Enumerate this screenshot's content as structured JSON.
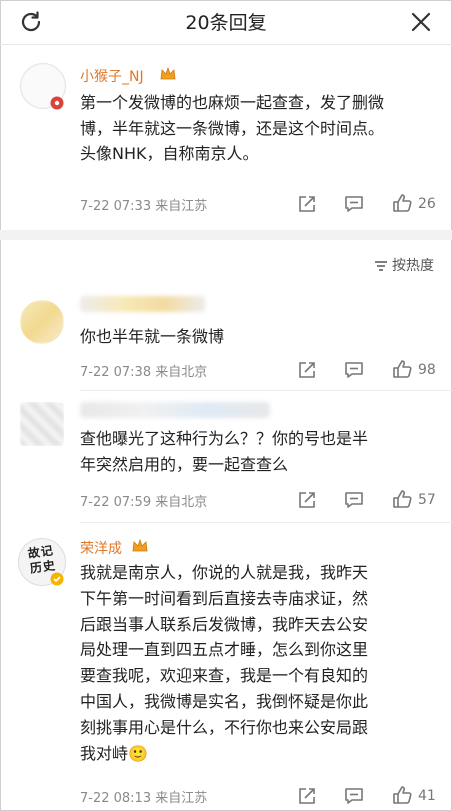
{
  "header": {
    "title": "20条回复"
  },
  "root_comment": {
    "username": "小猴子_NJ",
    "text_lines": [
      "第一个发微博的也麻烦一起查查，发了删微",
      "博，半年就这一条微博，还是这个时间点。",
      "头像NHK，自称南京人。"
    ],
    "meta": "7-22 07:33  来自江苏",
    "likes": "26"
  },
  "sort_label": "按热度",
  "replies": [
    {
      "text_lines": [
        "你也半年就一条微博"
      ],
      "meta": "7-22 07:38  来自北京",
      "likes": "98"
    },
    {
      "text_lines": [
        "查他曝光了这种行为么？？你的号也是半",
        "年突然启用的，要一起查查么"
      ],
      "meta": "7-22 07:59  来自北京",
      "likes": "57"
    },
    {
      "username": "荣洋成",
      "avatar_text": "故记历史",
      "text_lines": [
        "我就是南京人，你说的人就是我，我昨天",
        "下午第一时间看到后直接去寺庙求证，然",
        "后跟当事人联系后发微博，我昨天去公安",
        "局处理一直到四五点才睡，怎么到你这里",
        "要查我呢，欢迎来查，我是一个有良知的",
        "中国人，我微博是实名，我倒怀疑是你此",
        "刻挑事用心是什么，不行你也来公安局跟",
        "我对峙🙂"
      ],
      "meta": "7-22 08:13  来自江苏",
      "likes": "41"
    }
  ],
  "colors": {
    "username": "#e07828",
    "meta": "#8a8a8a",
    "accent_badge": "#d9443a"
  },
  "icons": [
    "refresh-icon",
    "close-icon",
    "crown-icon",
    "share-icon",
    "comment-icon",
    "like-icon",
    "sort-icon"
  ]
}
